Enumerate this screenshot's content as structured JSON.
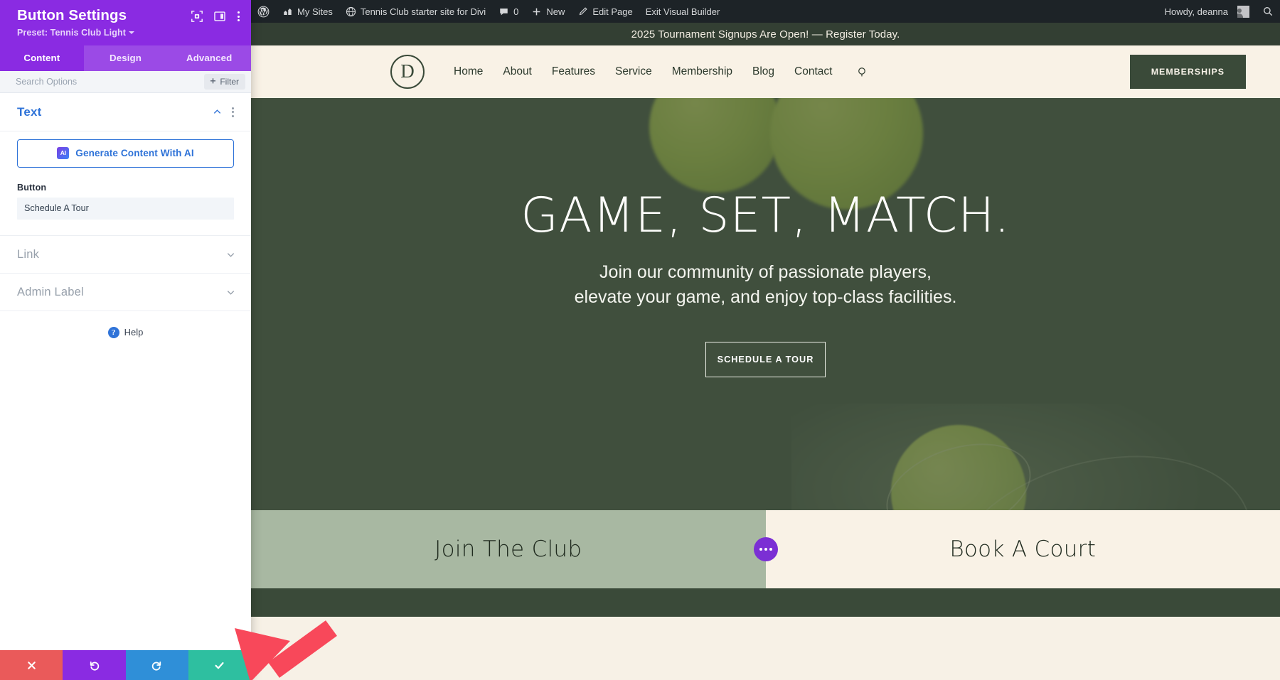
{
  "settings_panel": {
    "title": "Button Settings",
    "preset_label": "Preset: Tennis Club Light",
    "header_icons": [
      "focus-target-icon",
      "layout-panel-icon",
      "kebab-menu-icon"
    ],
    "tabs": [
      {
        "label": "Content",
        "active": true
      },
      {
        "label": "Design",
        "active": false
      },
      {
        "label": "Advanced",
        "active": false
      }
    ],
    "search": {
      "placeholder": "Search Options",
      "value": ""
    },
    "filter_button": "Filter",
    "sections": [
      {
        "name": "Text",
        "state": "open"
      },
      {
        "name": "Link",
        "state": "closed"
      },
      {
        "name": "Admin Label",
        "state": "closed"
      }
    ],
    "ai_button": "Generate Content With AI",
    "ai_badge": "AI",
    "button_field": {
      "label": "Button",
      "value": "Schedule A Tour"
    },
    "help": "Help",
    "actions": [
      {
        "name": "cancel",
        "glyph": "✕",
        "color": "#ea5a5a"
      },
      {
        "name": "undo",
        "glyph": "↺",
        "color": "#8a2be2"
      },
      {
        "name": "redo",
        "glyph": "↻",
        "color": "#2f8fd8"
      },
      {
        "name": "save",
        "glyph": "✓",
        "color": "#2ebfa0"
      }
    ]
  },
  "admin_bar": {
    "items": [
      {
        "label": "",
        "icon": "wordpress-logo-icon"
      },
      {
        "label": "My Sites",
        "icon": "sites-icon"
      },
      {
        "label": "Tennis Club starter site for Divi",
        "icon": "site-icon"
      },
      {
        "label": "0",
        "icon": "comment-icon"
      },
      {
        "label": "New",
        "icon": "plus-icon"
      },
      {
        "label": "Edit Page",
        "icon": "pencil-icon"
      },
      {
        "label": "Exit Visual Builder",
        "icon": ""
      }
    ],
    "howdy": "Howdy, deanna",
    "search_icon": "search-icon"
  },
  "site": {
    "announcement": "2025 Tournament Signups Are Open! — Register Today.",
    "logo_letter": "D",
    "nav_links": [
      "Home",
      "About",
      "Features",
      "Service",
      "Membership",
      "Blog",
      "Contact"
    ],
    "nav_cta": "MEMBERSHIPS",
    "hero": {
      "heading": "GAME, SET, MATCH.",
      "sub_line1": "Join our community of passionate players,",
      "sub_line2": "elevate your game, and enjoy top-class facilities.",
      "cta": "SCHEDULE A TOUR"
    },
    "dual": {
      "left": "Join The Club",
      "right": "Book A Court"
    }
  },
  "colors": {
    "panel_purple": "#8a2be2",
    "panel_purple_light": "#9b4ae6",
    "accent_blue": "#2f73d8",
    "site_dark_green": "#3a4a39",
    "site_cream": "#f9f2e6",
    "sage": "#a8b8a2",
    "arrow_red": "#f8485a",
    "save_teal": "#2ebfa0",
    "adminbar_dark": "#1d2327"
  }
}
